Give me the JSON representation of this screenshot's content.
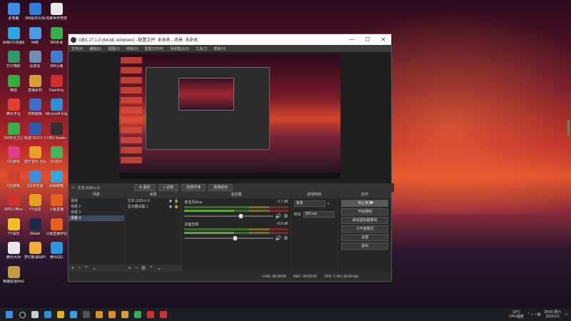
{
  "desktop_icons": [
    {
      "label": "此电脑",
      "color": "#3b8ee8"
    },
    {
      "label": "360驱动大师",
      "color": "#2d7fdc"
    },
    {
      "label": "完美世界竞技平台",
      "color": "#e8e8e8"
    },
    {
      "label": "网易UU加速器",
      "color": "#2aa7e0"
    },
    {
      "label": "网络",
      "color": "#4a9ae8"
    },
    {
      "label": "360杀毒",
      "color": "#36b04a"
    },
    {
      "label": "万兴喵影",
      "color": "#2d9a6a"
    },
    {
      "label": "回收站",
      "color": "#6a8fb0"
    },
    {
      "label": "360压缩",
      "color": "#3a7fd0"
    },
    {
      "label": "微信",
      "color": "#2fb13c"
    },
    {
      "label": "直播素材",
      "color": "#d8a030"
    },
    {
      "label": "FlashFxp",
      "color": "#d0302a"
    },
    {
      "label": "腾讯平台",
      "color": "#e04030"
    },
    {
      "label": "控制面板",
      "color": "#3a70c8"
    },
    {
      "label": "Microsoft Edge",
      "color": "#2d8fd8"
    },
    {
      "label": "360安全卫士",
      "color": "#36b04a"
    },
    {
      "label": "新建 DOCX 文档",
      "color": "#2a5db0"
    },
    {
      "label": "OBS Studio",
      "color": "#303030"
    },
    {
      "label": "QQ游戏",
      "color": "#e03a8a"
    },
    {
      "label": "拓竹音乐-全民K歌",
      "color": "#e8a020"
    },
    {
      "label": "QQ音乐",
      "color": "#40b860"
    },
    {
      "label": "QQ游戏",
      "color": "#d04030"
    },
    {
      "label": "QQ浏览器",
      "color": "#3a8ee0"
    },
    {
      "label": "网易邮箱",
      "color": "#30a8e0"
    },
    {
      "label": "WPS Office",
      "color": "#d03030"
    },
    {
      "label": "YY语音",
      "color": "#e8a020"
    },
    {
      "label": "斗鱼直播",
      "color": "#e86020"
    },
    {
      "label": "YY语音",
      "color": "#f0c020"
    },
    {
      "label": "Steam",
      "color": "#1a2a4a"
    },
    {
      "label": "斗鱼直播伴侣",
      "color": "#e86020"
    },
    {
      "label": "腾讯大师",
      "color": "#e8e8e8"
    },
    {
      "label": "梦幻新诛仙PC互通版",
      "color": "#f0b030"
    },
    {
      "label": "腾讯QQ",
      "color": "#2a9ae0"
    },
    {
      "label": "英雄联盟WeGame版",
      "color": "#c89a40"
    }
  ],
  "window": {
    "title": "OBS 27.1.3 (64-bit, windows) - 配置文件: 未命名 - 场景: 未命名",
    "menu": [
      "文件(F)",
      "编辑(E)",
      "视图(V)",
      "停靠(D)",
      "配置文件(P)",
      "场景集合(S)",
      "工具(T)",
      "帮助(H)"
    ]
  },
  "controls_bar": {
    "source_label": "文本 (GDI+) 0",
    "properties": "属性",
    "filters": "滤镜",
    "btn_a": "选择字体",
    "btn_b": "选择颜色"
  },
  "scenes": {
    "title": "场景",
    "items": [
      "场景",
      "场景 2",
      "场景 3",
      "场景 4"
    ],
    "selected": 3
  },
  "sources": {
    "title": "来源",
    "items": [
      "文本 (GDI+) 0",
      "显示器采集 1"
    ]
  },
  "mixer": {
    "title": "混音器",
    "channels": [
      {
        "name": "麦克风/Aux",
        "db": "-3.7 dB",
        "level": 0.62
      },
      {
        "name": "桌面音频",
        "db": "-8.8 dB",
        "level": 0.55
      }
    ]
  },
  "transitions": {
    "title": "转场特效",
    "type": "渐变",
    "duration_label": "时长",
    "duration": "300 ms"
  },
  "controls": {
    "title": "控件",
    "buttons": [
      "停止推流",
      "开始录制",
      "启动虚拟摄像机",
      "工作室模式",
      "设置",
      "退出"
    ]
  },
  "status": {
    "live": "LIVE: 00:00:00",
    "rec": "REC: 00:00:00",
    "cpu": "CPU: 1.4%, 60.00 fps"
  },
  "taskbar": {
    "apps": [
      {
        "name": "windows-icon",
        "color": "#3a8ee8"
      },
      {
        "name": "search-icon",
        "color": "#cccccc"
      },
      {
        "name": "taskview-icon",
        "color": "#cccccc"
      },
      {
        "name": "edge-icon",
        "color": "#2d8fd8"
      },
      {
        "name": "explorer-icon",
        "color": "#e8b020"
      },
      {
        "name": "qq-browser-icon",
        "color": "#3aa0e0"
      },
      {
        "name": "obs-icon",
        "color": "#555555"
      },
      {
        "name": "app-icon",
        "color": "#e09020"
      },
      {
        "name": "app-icon",
        "color": "#e09020"
      },
      {
        "name": "app-icon",
        "color": "#d8a030"
      },
      {
        "name": "app-icon",
        "color": "#30b050"
      },
      {
        "name": "app-icon",
        "color": "#d03030"
      },
      {
        "name": "app-icon",
        "color": "#d03030"
      }
    ],
    "weather": "13°C",
    "weather_sub": "CPU温度",
    "time": "20:55 周六",
    "date": "2022/1/1"
  }
}
